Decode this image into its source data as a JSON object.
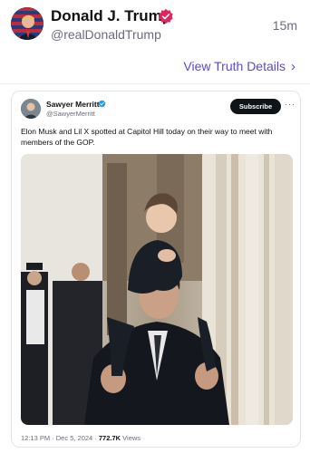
{
  "post": {
    "author_name": "Donald J. Trump",
    "author_handle": "@realDonaldTrump",
    "time": "15m",
    "view_details": "View Truth Details",
    "verified_color": "#e0245e"
  },
  "embed": {
    "name": "Sawyer Merritt",
    "handle": "@SawyerMerritt",
    "subscribe": "Subscribe",
    "text": "Elon Musk and Lil X spotted at Capitol Hill today on their way to meet with members of the GOP.",
    "date": "12:13 PM · Dec 5, 2024 · ",
    "views_count": "772.7K",
    "views_label": " Views",
    "verified_color": "#1d9bf0"
  },
  "accent_color": "#5b49d6"
}
